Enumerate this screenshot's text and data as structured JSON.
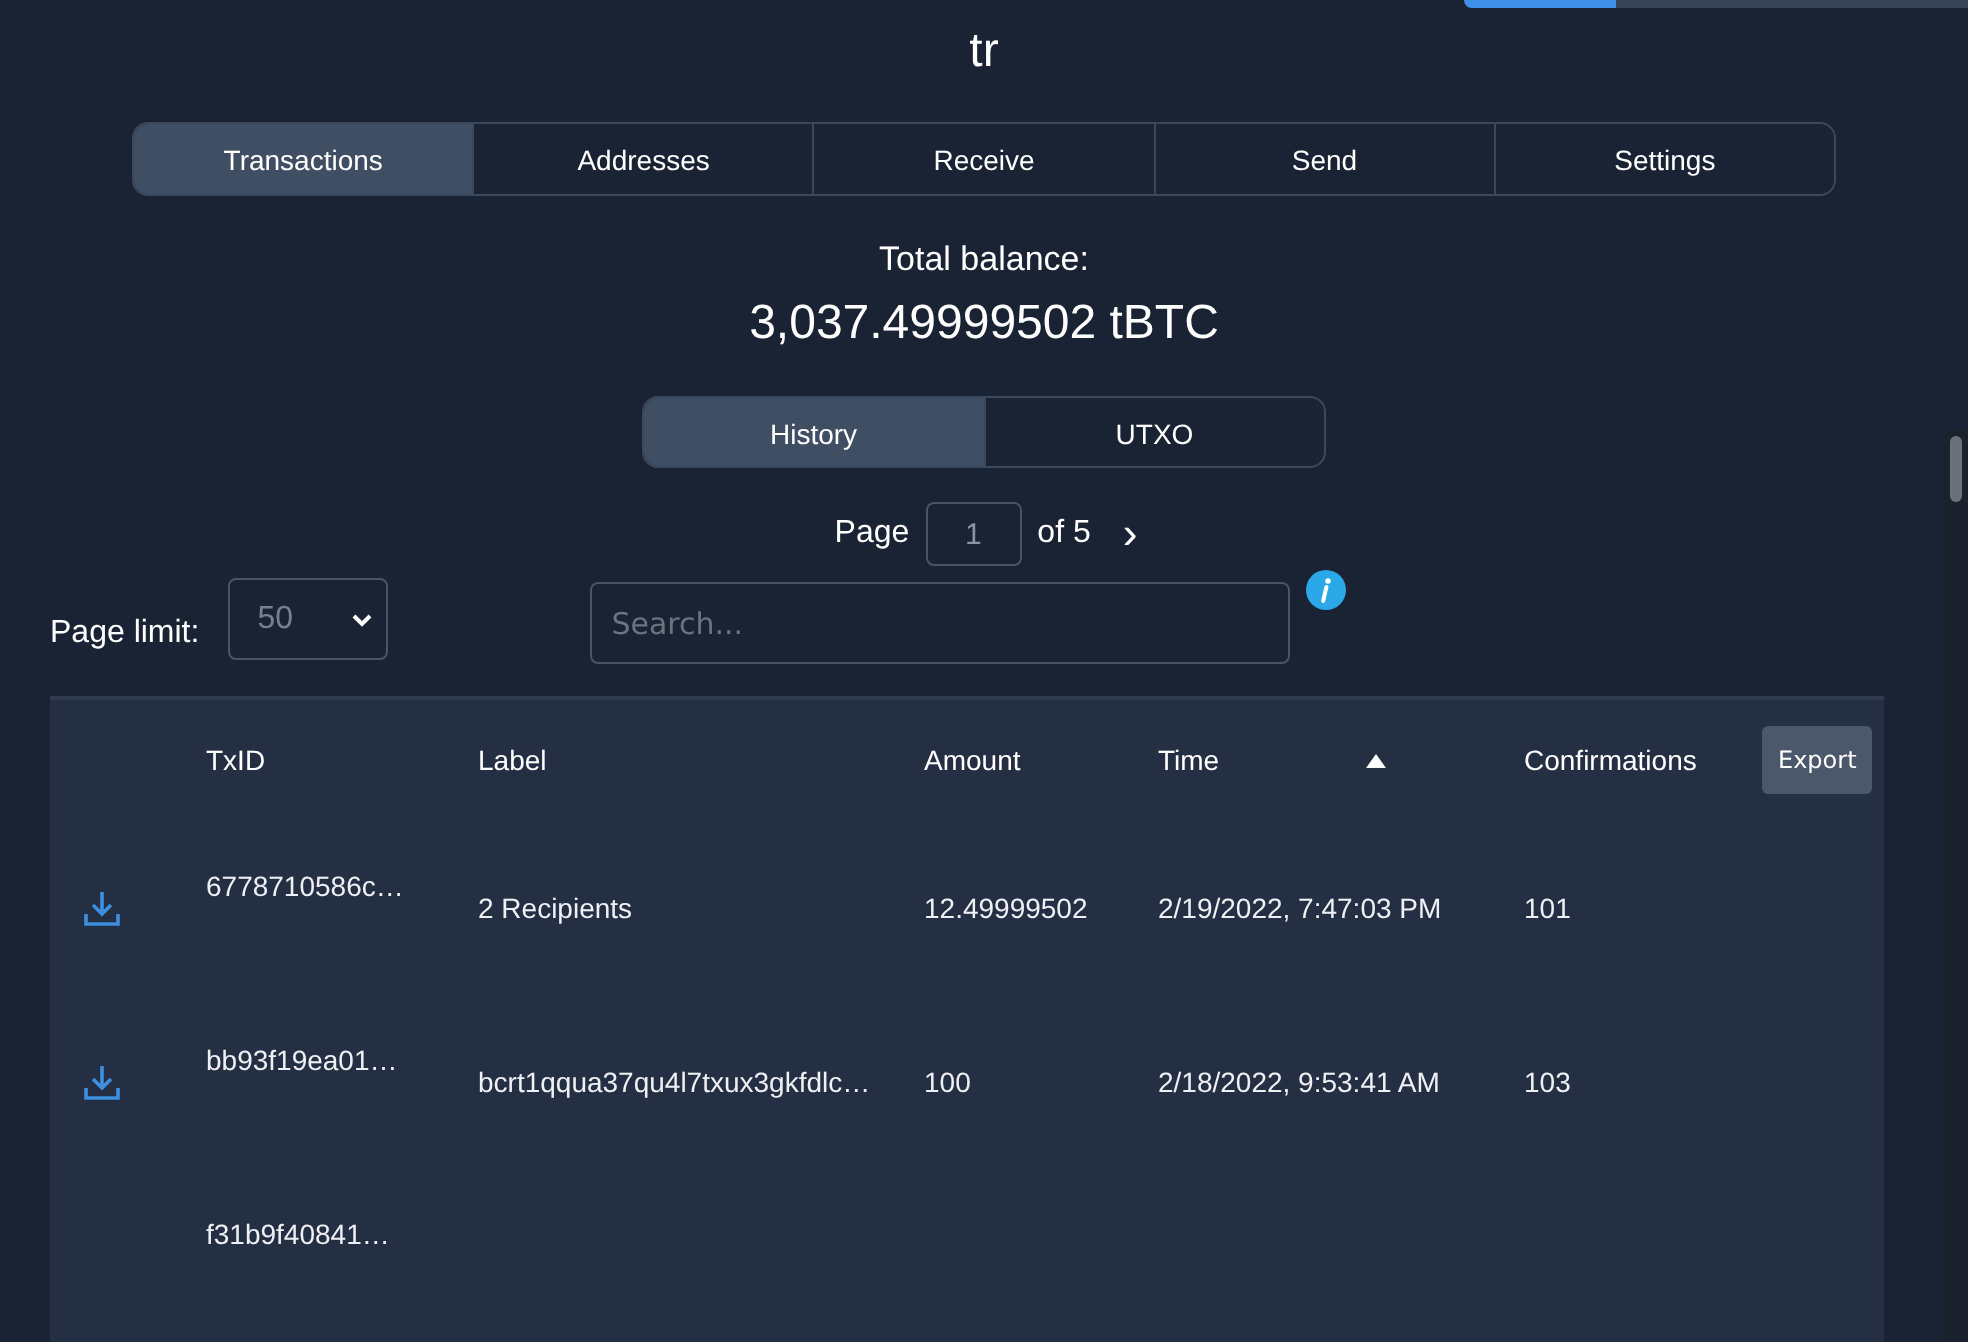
{
  "wallet": {
    "name": "tr"
  },
  "tabs": [
    {
      "label": "Transactions",
      "selected": true
    },
    {
      "label": "Addresses",
      "selected": false
    },
    {
      "label": "Receive",
      "selected": false
    },
    {
      "label": "Send",
      "selected": false
    },
    {
      "label": "Settings",
      "selected": false
    }
  ],
  "balance": {
    "label": "Total balance:",
    "value": "3,037.49999502 tBTC"
  },
  "view_tabs": [
    {
      "label": "History",
      "selected": true
    },
    {
      "label": "UTXO",
      "selected": false
    }
  ],
  "pagination": {
    "label": "Page",
    "value": "1",
    "of": "of 5",
    "next": "›"
  },
  "page_limit": {
    "label": "Page limit:",
    "value": "50"
  },
  "search": {
    "placeholder": "Search..."
  },
  "table": {
    "columns": [
      {
        "label": "TxID",
        "sorted": false
      },
      {
        "label": "Label",
        "sorted": false
      },
      {
        "label": "Amount",
        "sorted": false
      },
      {
        "label": "Time",
        "sorted": true
      },
      {
        "label": "Confirmations",
        "sorted": false
      }
    ],
    "export": "Export",
    "rows": [
      {
        "txid": "6778710586c…",
        "label": "2 Recipients",
        "amount": "12.49999502",
        "time": "2/19/2022, 7:47:03 PM",
        "confirmations": "101"
      },
      {
        "txid": "bb93f19ea01…",
        "label": "bcrt1qqua37qu4l7txux3gkfdlc…",
        "amount": "100",
        "time": "2/18/2022, 9:53:41 AM",
        "confirmations": "103"
      },
      {
        "txid": "f31b9f40841…"
      }
    ]
  }
}
